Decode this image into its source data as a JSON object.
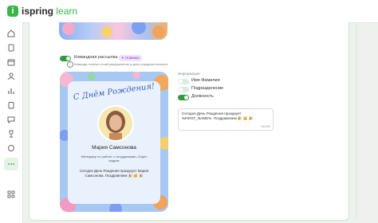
{
  "brand": {
    "name_prefix": "ispring",
    "name_suffix": "learn",
    "mark": "i"
  },
  "sidebar": {
    "items": [
      {
        "name": "home",
        "icon": "home-icon",
        "active": false
      },
      {
        "name": "courses",
        "icon": "book-icon",
        "active": false
      },
      {
        "name": "calendar",
        "icon": "calendar-icon",
        "active": false
      },
      {
        "name": "users",
        "icon": "users-icon",
        "active": false
      },
      {
        "name": "reports",
        "icon": "chart-icon",
        "active": false
      },
      {
        "name": "tasks",
        "icon": "clipboard-icon",
        "active": false
      },
      {
        "name": "messages",
        "icon": "chat-icon",
        "active": false
      },
      {
        "name": "achievements",
        "icon": "trophy-icon",
        "active": false
      },
      {
        "name": "more",
        "icon": "dots-icon",
        "active": true
      },
      {
        "name": "settings",
        "icon": "settings-icon",
        "active": false
      }
    ]
  },
  "newsletter": {
    "label": "Командная рассылка",
    "badge": "✦ Новинка",
    "hint": "Команда получит email-уведомление в день рождения коллеги",
    "enabled": true
  },
  "card": {
    "title": "С Днём Рождения!",
    "name": "Мария Самсонова",
    "role": "Менеджер по работе с сотрудниками, Отдел кадров",
    "message": "Сегодня День Рождения празднует Мария Самсонова. Поздравляем 🎉 🥳 🎉"
  },
  "info": {
    "label": "Информация",
    "toggles": [
      {
        "label": "Имя Фамилия",
        "on": false
      },
      {
        "label": "Подразделение",
        "on": false
      },
      {
        "label": "Должность",
        "on": true
      }
    ]
  },
  "textbox": {
    "text": "Сегодня День Рождения празднует %FIRST_NAME%. Поздравляем 🎉 🥳 🎉",
    "counter": "64/150"
  },
  "colors": {
    "brand_green": "#3ab54a",
    "toggle_on": "#2f9b3e",
    "badge_purple": "#7a3cc9"
  }
}
